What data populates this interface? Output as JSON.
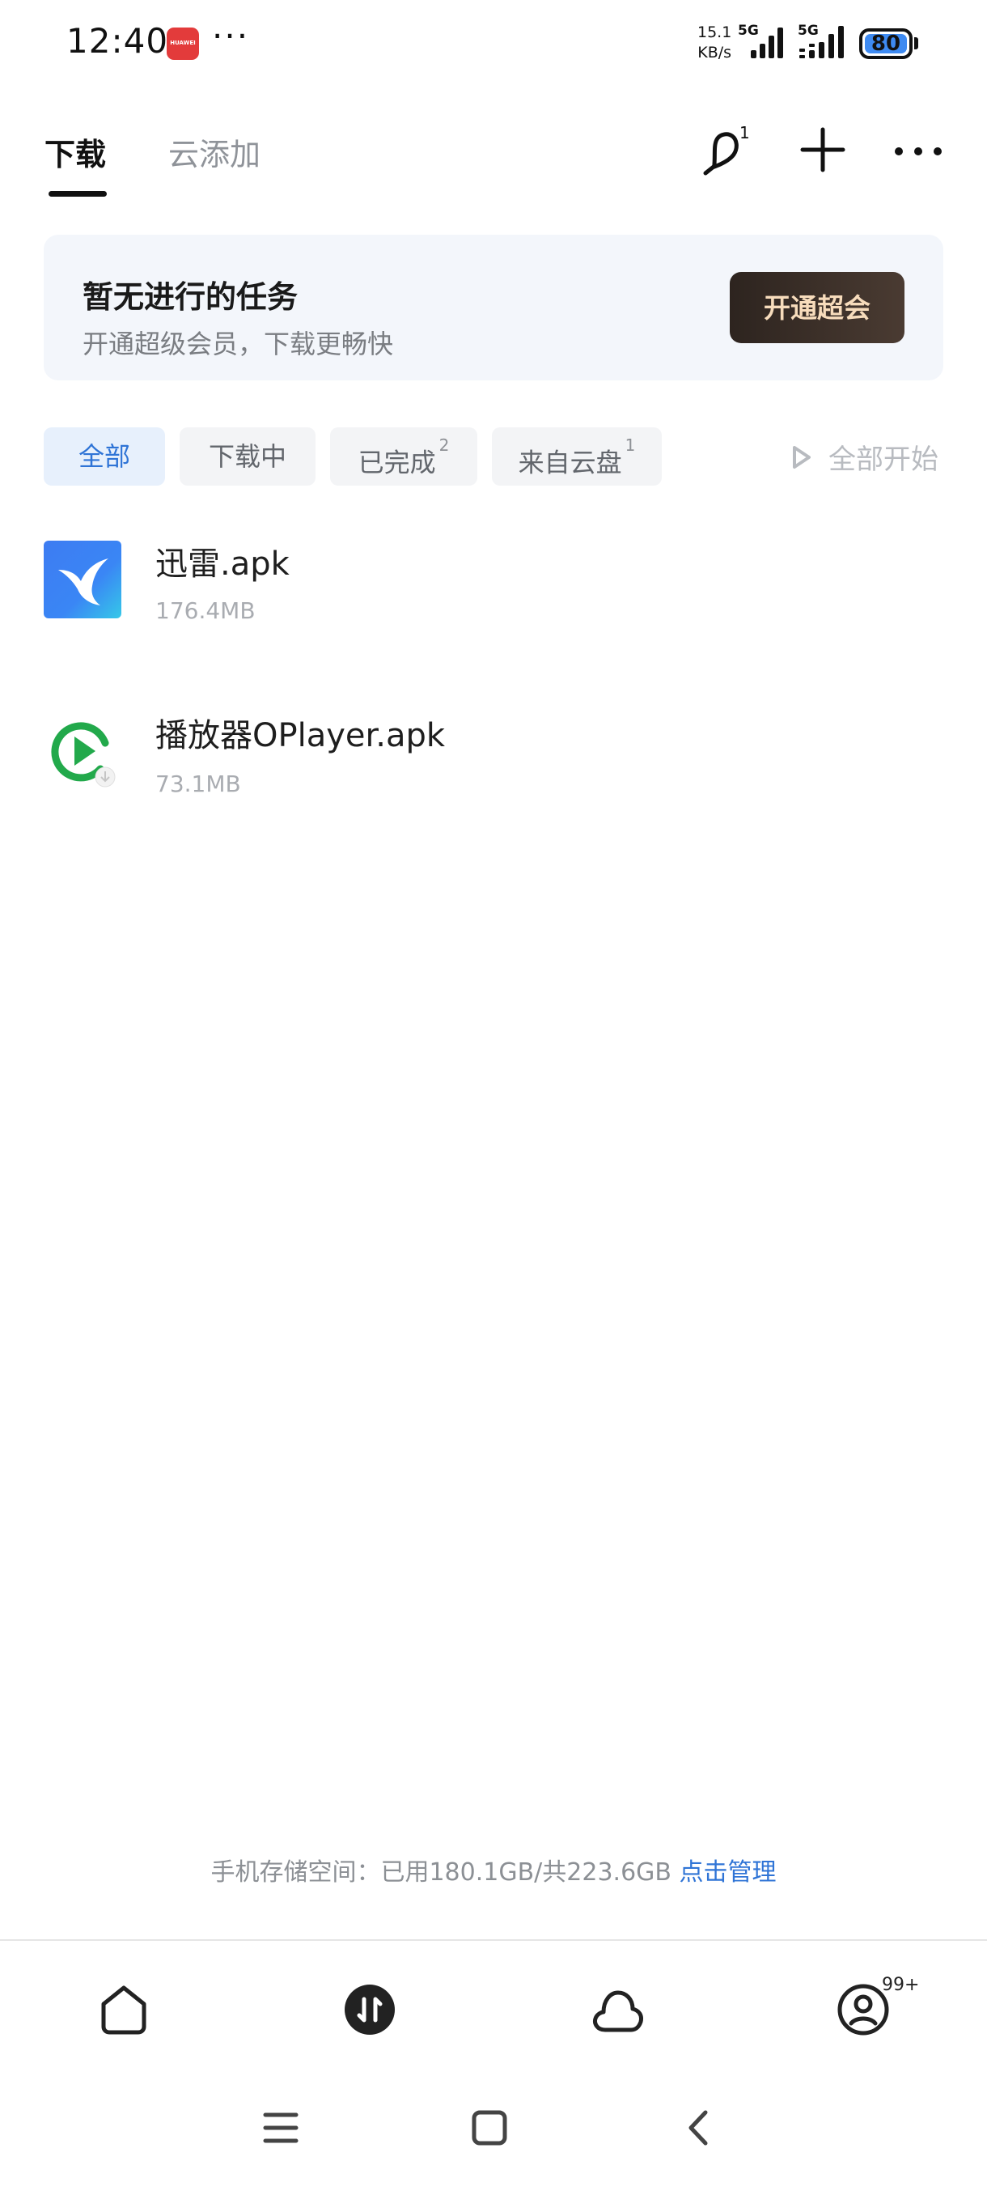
{
  "status_bar": {
    "time": "12:40",
    "app_icon": "huawei-appgallery-icon",
    "app_icon_text": "HUAWEI",
    "more": "···",
    "net_speed_value": "15.1",
    "net_speed_unit": "KB/s",
    "signal1": "5G",
    "signal2": "5G",
    "battery": "80"
  },
  "header": {
    "tabs": [
      {
        "label": "下载",
        "active": true
      },
      {
        "label": "云添加",
        "active": false
      }
    ],
    "notification_badge": "1",
    "icons": [
      "bell-icon",
      "plus-icon",
      "more-icon"
    ]
  },
  "banner": {
    "title": "暂无进行的任务",
    "subtitle": "开通超级会员，下载更畅快",
    "button": "开通超会"
  },
  "filters": {
    "chips": [
      {
        "label": "全部",
        "count": ""
      },
      {
        "label": "下载中",
        "count": ""
      },
      {
        "label": "已完成",
        "count": "2"
      },
      {
        "label": "来自云盘",
        "count": "1"
      }
    ],
    "start_all": "全部开始"
  },
  "files": [
    {
      "name": "迅雷.apk",
      "size": "176.4MB",
      "icon": "thunder-bird-icon"
    },
    {
      "name": "播放器OPlayer.apk",
      "size": "73.1MB",
      "icon": "oplayer-play-icon"
    }
  ],
  "storage": {
    "text": "手机存储空间：已用180.1GB/共223.6GB",
    "action": "点击管理"
  },
  "bottom_nav": {
    "items": [
      "home-icon",
      "transfer-icon",
      "cloud-icon",
      "profile-icon"
    ],
    "profile_badge": "99+"
  },
  "system_nav": [
    "menu-icon",
    "home-square-icon",
    "back-icon"
  ],
  "colors": {
    "accent": "#2f74d6",
    "vip_button_bg": "#3a2e28",
    "vip_button_text": "#f7dcbc",
    "banner_bg": "#f3f6fb"
  }
}
